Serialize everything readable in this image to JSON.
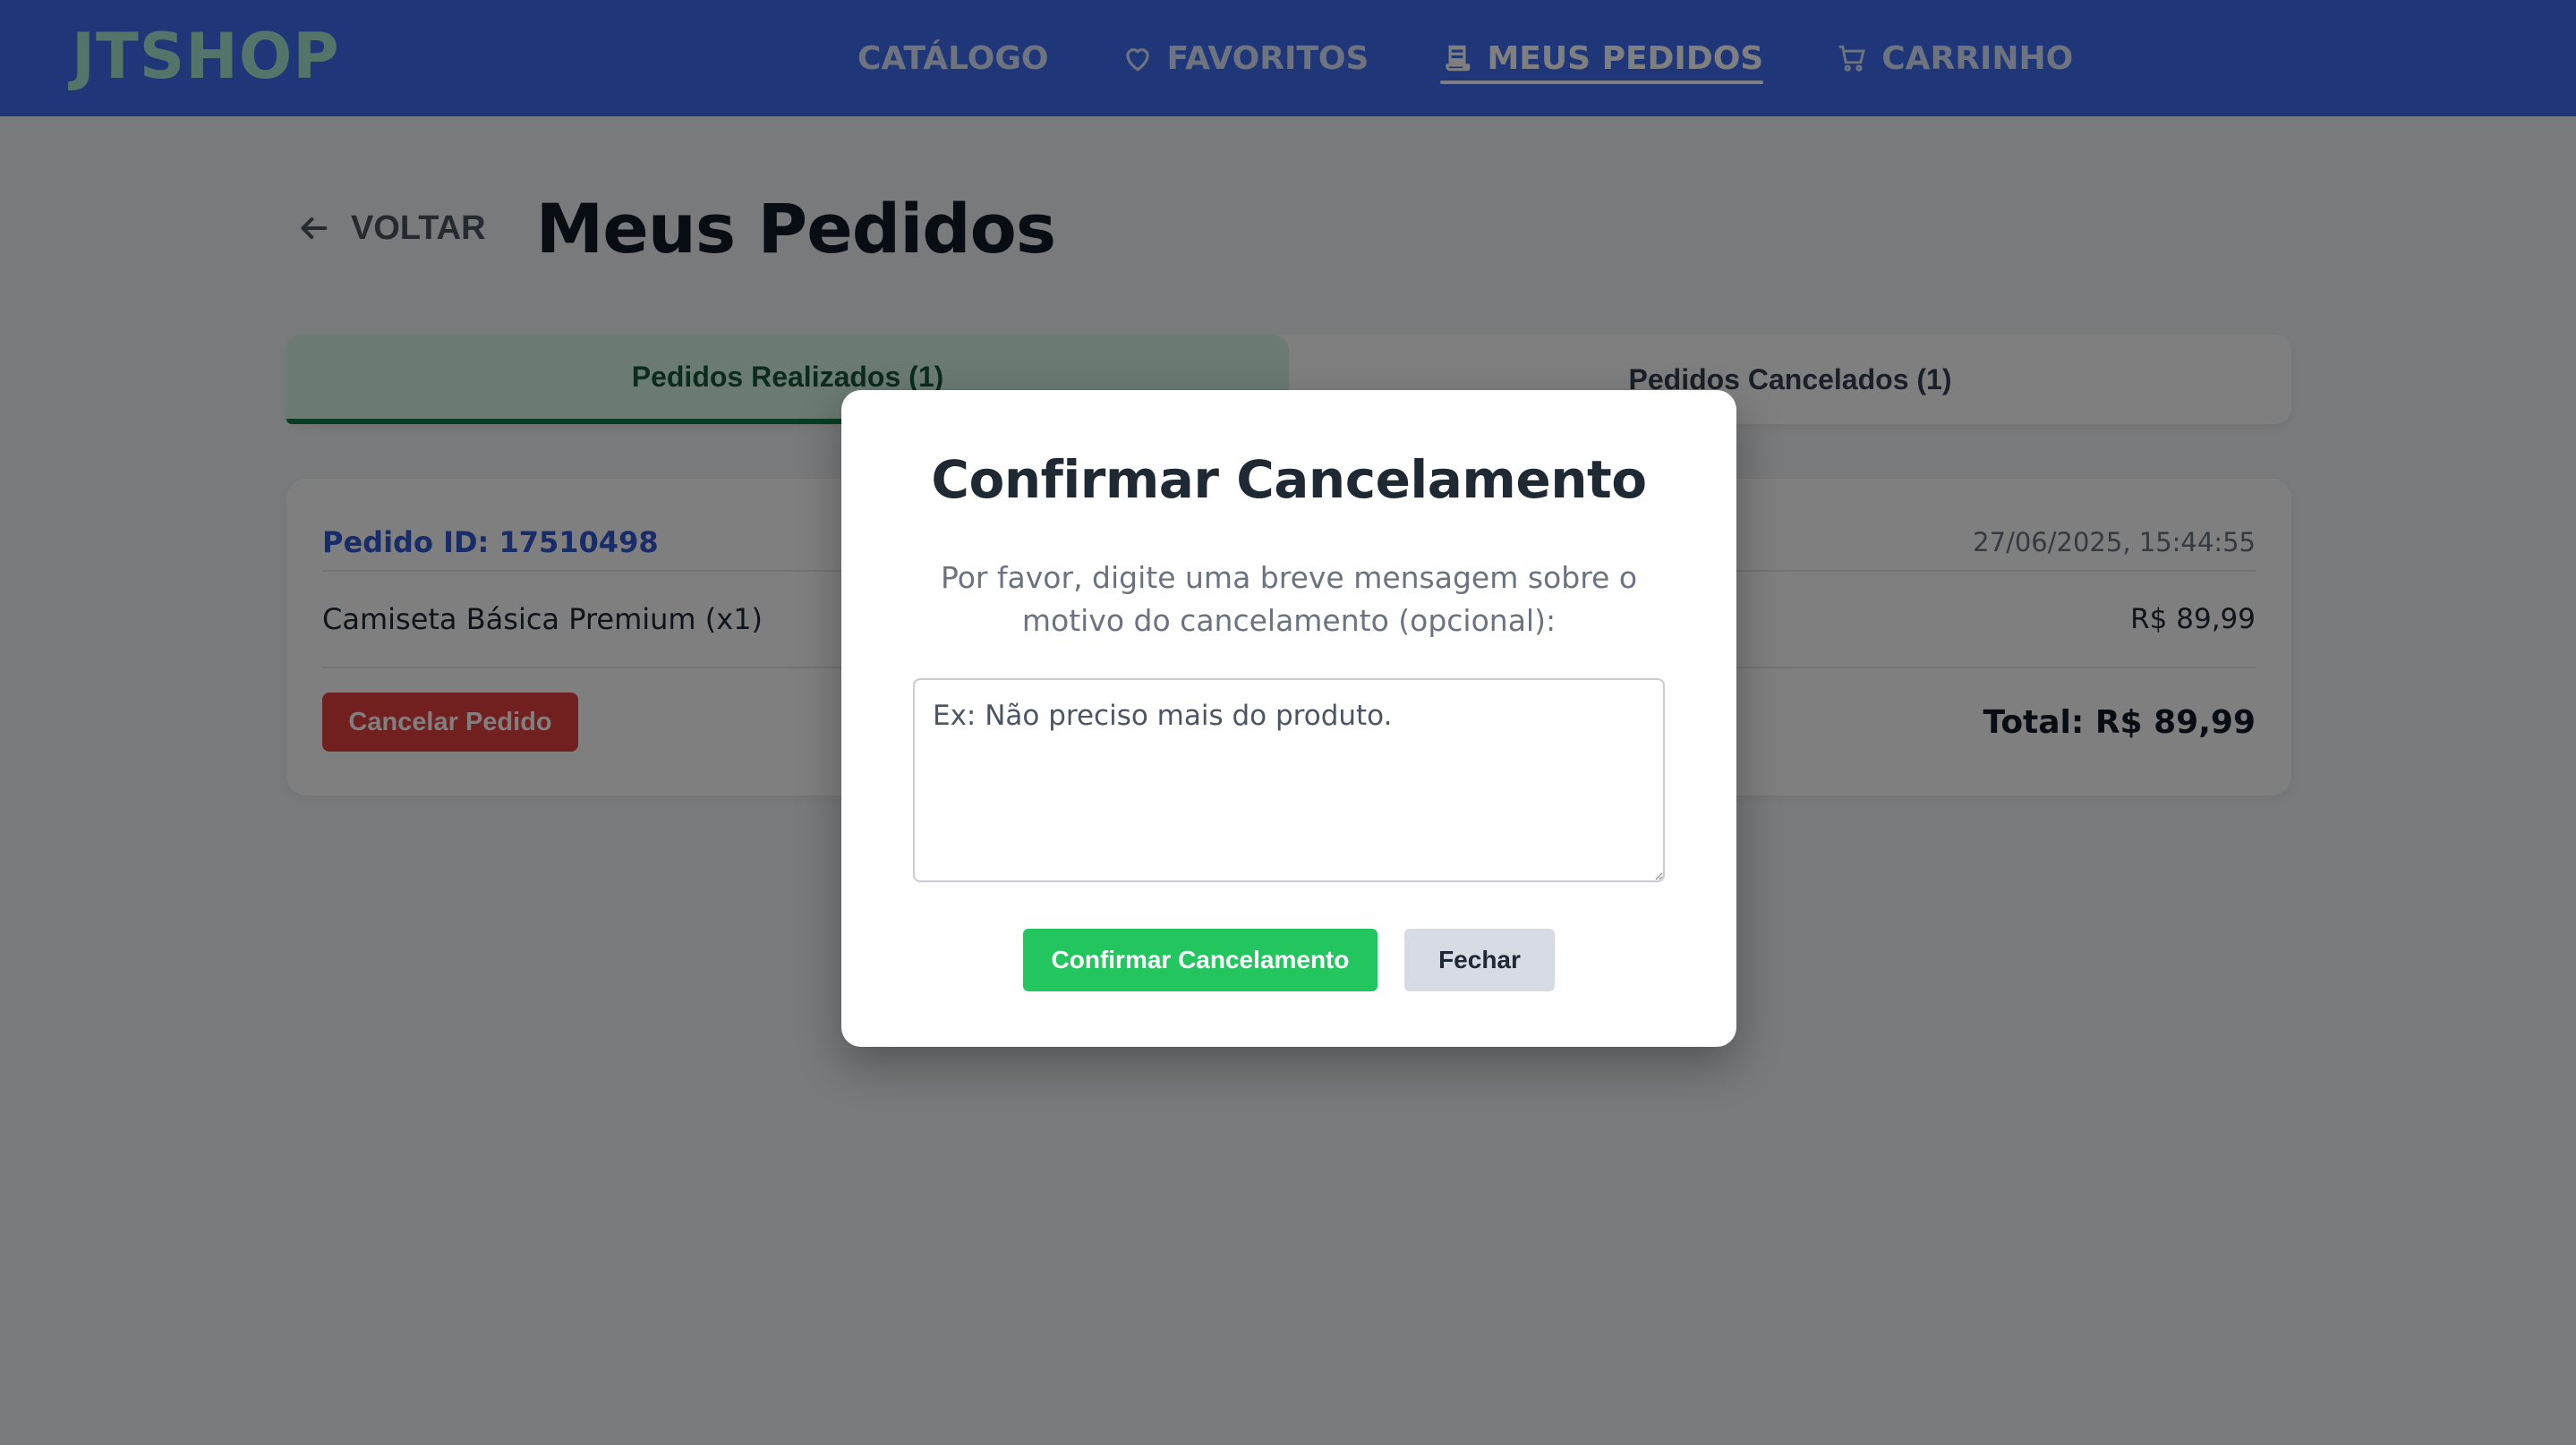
{
  "header": {
    "logo": "JTSHOP",
    "nav": [
      {
        "label": "CATÁLOGO",
        "icon": "none"
      },
      {
        "label": "FAVORITOS",
        "icon": "heart-icon"
      },
      {
        "label": "MEUS PEDIDOS",
        "icon": "receipt-icon",
        "active": true
      },
      {
        "label": "CARRINHO",
        "icon": "cart-icon"
      }
    ]
  },
  "page": {
    "back_label": "VOLTAR",
    "title": "Meus Pedidos"
  },
  "tabs": [
    {
      "label": "Pedidos Realizados (1)",
      "active": true
    },
    {
      "label": "Pedidos Cancelados (1)",
      "active": false
    }
  ],
  "order": {
    "id_label": "Pedido ID: 17510498",
    "date": "27/06/2025, 15:44:55",
    "item_name": "Camiseta Básica Premium (x1)",
    "item_price": "R$ 89,99",
    "cancel_button": "Cancelar Pedido",
    "total": "Total: R$ 89,99"
  },
  "modal": {
    "title": "Confirmar Cancelamento",
    "message": "Por favor, digite uma breve mensagem sobre o motivo do cancelamento (opcional):",
    "placeholder": "Ex: Não preciso mais do produto.",
    "value": "",
    "confirm_button": "Confirmar Cancelamento",
    "close_button": "Fechar"
  },
  "colors": {
    "header_bg": "#3f6ff0",
    "logo": "#a9e8d2",
    "active_tab_bg": "#d6f5e6",
    "active_tab_text": "#14593a",
    "order_id": "#3158d4",
    "danger": "#e53e3e",
    "success": "#22c55e",
    "neutral_button": "#d7dbe3"
  }
}
